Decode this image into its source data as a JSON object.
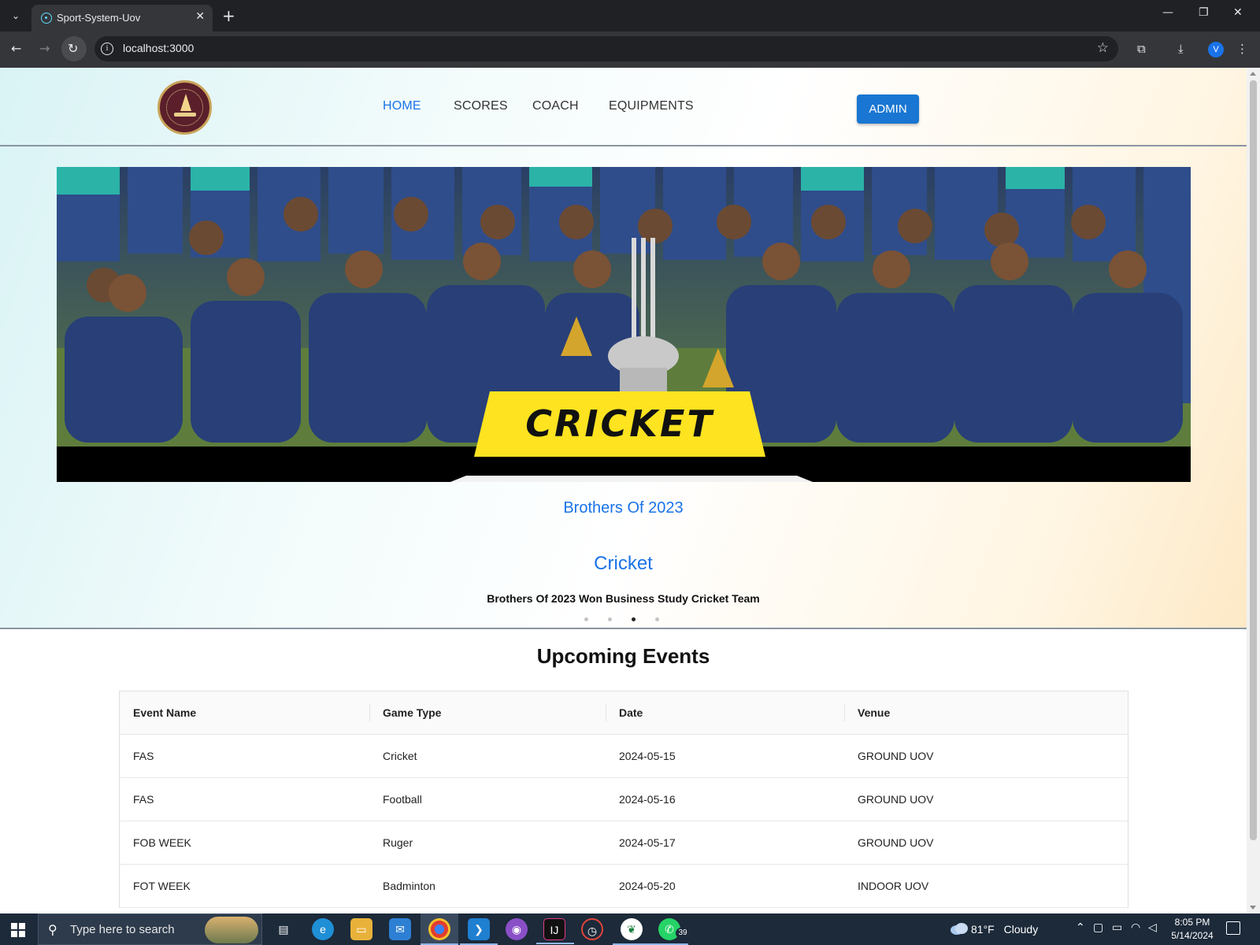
{
  "browser": {
    "tab_title": "Sport-System-Uov",
    "url": "localhost:3000",
    "profile_initial": "V"
  },
  "nav": {
    "items": [
      {
        "label": "HOME",
        "active": true
      },
      {
        "label": "SCORES",
        "active": false
      },
      {
        "label": "COACH",
        "active": false
      },
      {
        "label": "EQUIPMENTS",
        "active": false
      }
    ],
    "admin_label": "ADMIN"
  },
  "hero": {
    "image_banner_text": "CRICKET",
    "caption_title": "Brothers Of 2023",
    "caption_sport": "Cricket",
    "caption_description": "Brothers Of 2023 Won Business Study Cricket Team",
    "slide_count": 4,
    "active_slide": 3
  },
  "events": {
    "title": "Upcoming Events",
    "columns": [
      "Event Name",
      "Game Type",
      "Date",
      "Venue"
    ],
    "rows": [
      [
        "FAS",
        "Cricket",
        "2024-05-15",
        "GROUND UOV"
      ],
      [
        "FAS",
        "Football",
        "2024-05-16",
        "GROUND UOV"
      ],
      [
        "FOB WEEK",
        "Ruger",
        "2024-05-17",
        "GROUND UOV"
      ],
      [
        "FOT WEEK",
        "Badminton",
        "2024-05-20",
        "INDOOR UOV"
      ]
    ]
  },
  "taskbar": {
    "search_placeholder": "Type here to search",
    "weather_temp": "81°F",
    "weather_desc": "Cloudy",
    "time": "8:05 PM",
    "date": "5/14/2024",
    "whatsapp_badge": "39"
  },
  "colors": {
    "accent": "#1a73e8",
    "admin_button": "#1976d2",
    "banner_yellow": "#fde320"
  }
}
